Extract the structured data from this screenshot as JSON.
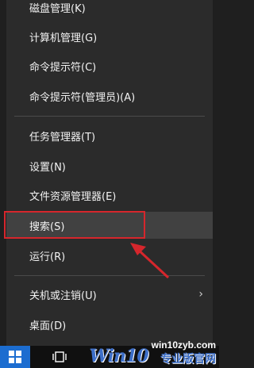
{
  "menu": {
    "items": [
      {
        "label": "磁盘管理(K)"
      },
      {
        "label": "计算机管理(G)"
      },
      {
        "label": "命令提示符(C)"
      },
      {
        "label": "命令提示符(管理员)(A)"
      },
      {
        "label": "任务管理器(T)"
      },
      {
        "label": "设置(N)"
      },
      {
        "label": "文件资源管理器(E)"
      },
      {
        "label": "搜索(S)"
      },
      {
        "label": "运行(R)"
      },
      {
        "label": "关机或注销(U)"
      },
      {
        "label": "桌面(D)"
      }
    ],
    "selected_item": "搜索(S)",
    "submenu_indicator": "›"
  },
  "annotation": {
    "color": "#d6262c"
  },
  "taskbar": {
    "start_icon": "windows-logo-icon",
    "taskview_icon": "task-view-icon"
  },
  "watermark": {
    "logo": "Win10",
    "site": "win10zyb.com",
    "text": "专业版官网"
  }
}
